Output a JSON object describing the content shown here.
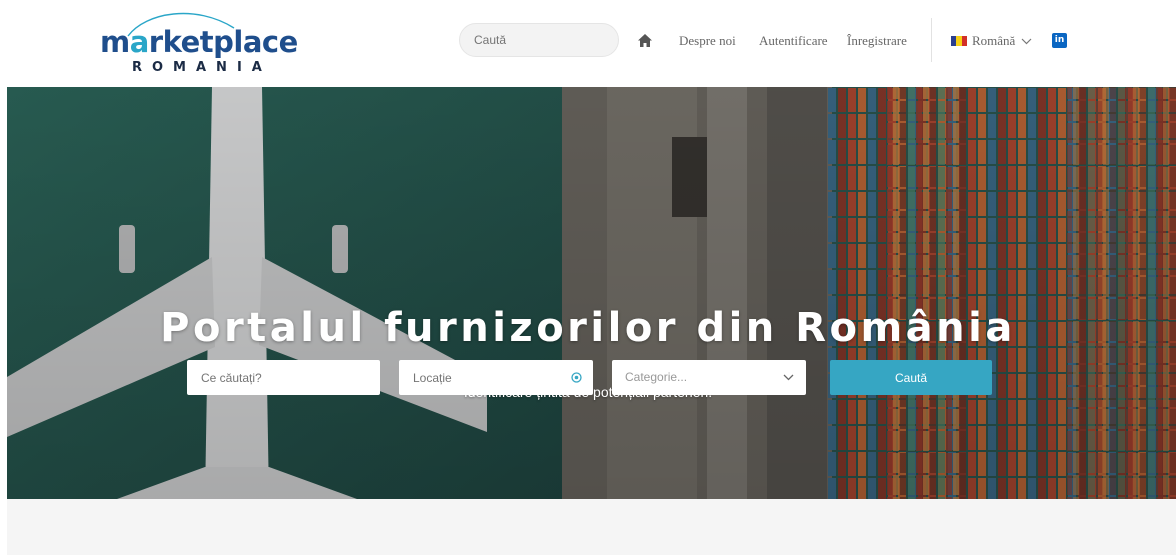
{
  "brand": {
    "logo_main_a": "m",
    "logo_main_b": "a",
    "logo_main_c": "rketplace",
    "logo_sub": "ROMANIA",
    "colors": {
      "navy": "#1f4e8c",
      "teal": "#2aa6c8"
    }
  },
  "header": {
    "search_placeholder": "Caută",
    "home_icon": "home-icon",
    "nav": [
      "Despre noi",
      "Autentificare",
      "Înregistrare"
    ],
    "language": "Română",
    "language_flag": "romania-flag-icon",
    "social": "in"
  },
  "hero": {
    "title": "Portalul furnizorilor din România",
    "subtitle": "Identificare țintită de potențiali parteneri.",
    "search": {
      "what_placeholder": "Ce căutați?",
      "location_placeholder": "Locație",
      "category_value": "Categorie...",
      "button_label": "Caută"
    }
  },
  "colors": {
    "accent": "#36a6c3",
    "footer_band": "#f5f5f5"
  }
}
